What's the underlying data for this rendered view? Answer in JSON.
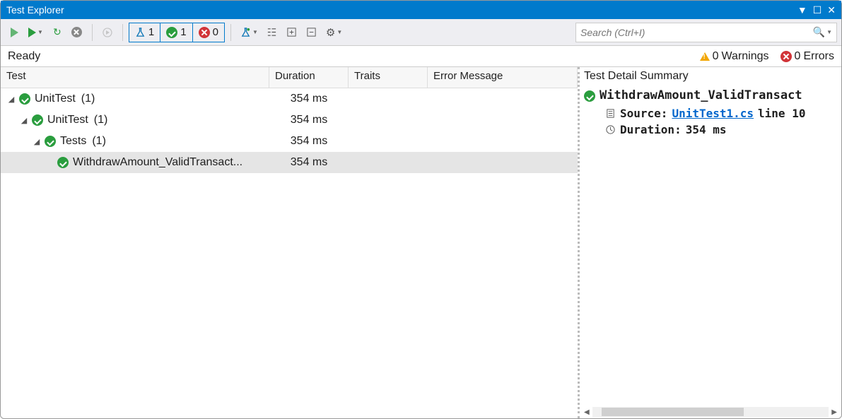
{
  "titlebar": {
    "title": "Test Explorer"
  },
  "search": {
    "placeholder": "Search (Ctrl+I)"
  },
  "filter_counts": {
    "total": "1",
    "passed": "1",
    "failed": "0"
  },
  "status": {
    "text": "Ready",
    "warnings_count": "0",
    "warnings_label": "Warnings",
    "errors_count": "0",
    "errors_label": "Errors"
  },
  "columns": {
    "test": "Test",
    "duration": "Duration",
    "traits": "Traits",
    "error": "Error Message"
  },
  "tree": {
    "r0": {
      "label": "UnitTest",
      "count": "(1)",
      "dur": "354 ms"
    },
    "r1": {
      "label": "UnitTest",
      "count": "(1)",
      "dur": "354 ms"
    },
    "r2": {
      "label": "Tests",
      "count": "(1)",
      "dur": "354 ms"
    },
    "r3": {
      "label": "WithdrawAmount_ValidTransact...",
      "dur": "354 ms"
    }
  },
  "detail": {
    "header": "Test Detail Summary",
    "name": "WithdrawAmount_ValidTransact",
    "source_label": "Source:",
    "source_file": "UnitTest1.cs",
    "source_line": "line 10",
    "duration_label": "Duration:",
    "duration_value": "354 ms"
  }
}
